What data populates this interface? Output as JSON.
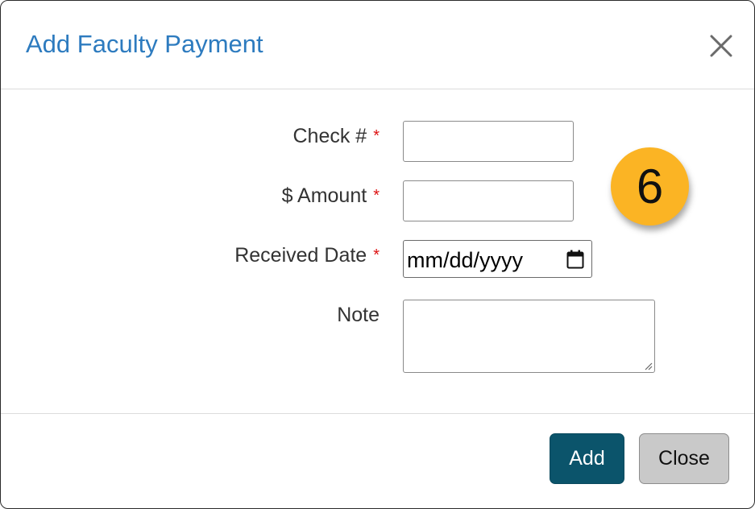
{
  "dialog": {
    "title": "Add Faculty Payment",
    "close_icon": "close-icon"
  },
  "form": {
    "check": {
      "label": "Check #",
      "required_mark": "*",
      "value": ""
    },
    "amount": {
      "label": "$ Amount",
      "required_mark": "*",
      "value": ""
    },
    "received_date": {
      "label": "Received Date",
      "required_mark": "*",
      "placeholder": "mm/dd/yyyy",
      "icon": "calendar-icon"
    },
    "note": {
      "label": "Note",
      "value": ""
    }
  },
  "step_badge": {
    "number": "6",
    "color": "#fbb424"
  },
  "footer": {
    "add_label": "Add",
    "close_label": "Close"
  },
  "colors": {
    "title": "#2d7bbf",
    "required": "#dd1111",
    "add_button": "#0b546b",
    "close_button": "#c9c9c9"
  }
}
